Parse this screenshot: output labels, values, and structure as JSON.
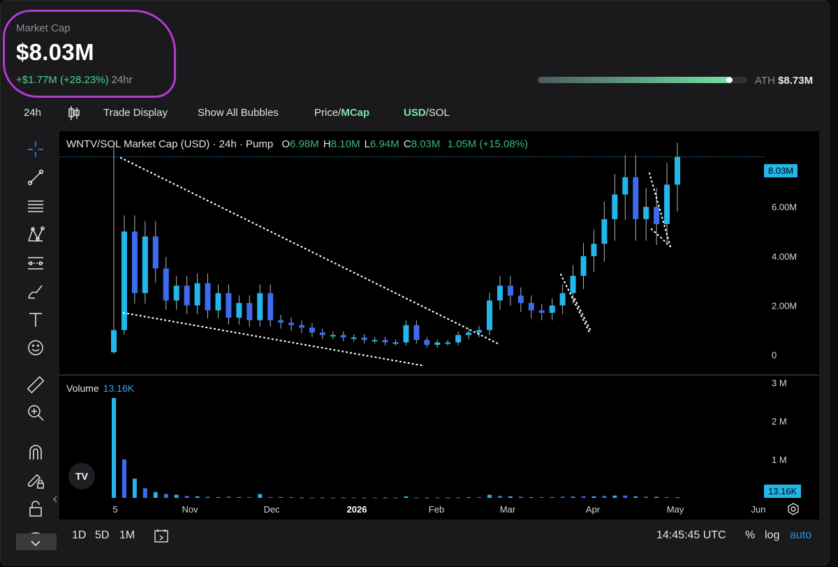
{
  "header": {
    "market_cap_label": "Market Cap",
    "market_cap_value": "$8.03M",
    "change_value": "+$1.77M (+28.23%)",
    "change_period": "24hr",
    "ath_label": "ATH",
    "ath_value": "$8.73M",
    "ath_progress": 0.92
  },
  "toolbar": {
    "interval": "24h",
    "trade_display": "Trade Display",
    "show_bubbles": "Show All Bubbles",
    "price_label": "Price/",
    "mcap_label": "MCap",
    "usd_label": "USD",
    "sol_label": "/SOL"
  },
  "legend": {
    "title": "WNTV/SOL Market Cap (USD) · 24h · Pump",
    "o_key": "O",
    "o_val": "6.98M",
    "h_key": "H",
    "h_val": "8.10M",
    "l_key": "L",
    "l_val": "6.94M",
    "c_key": "C",
    "c_val": "8.03M",
    "change": "1.05M (+15.08%)",
    "price_tag": "8.03M"
  },
  "volume": {
    "label": "Volume",
    "value": "13.16K",
    "tag": "13.16K"
  },
  "left_tools": [
    "crosshair-icon",
    "trendline-icon",
    "horizontal-lines-icon",
    "pattern-icon",
    "measure-lines-icon",
    "brush-icon",
    "text-icon",
    "emoji-icon",
    "ruler-icon",
    "zoom-in-icon",
    "magnet-icon",
    "lock-pencil-icon",
    "lock-icon",
    "eye-icon"
  ],
  "bottom": {
    "range_1d": "1D",
    "range_5d": "5D",
    "range_1m": "1M",
    "time": "14:45:45 UTC",
    "percent": "%",
    "log": "log",
    "auto": "auto"
  },
  "chart_data": {
    "type": "candlestick",
    "title": "WNTV/SOL Market Cap (USD) · 24h · Pump",
    "y_ticks": [
      "8.03M",
      "6.00M",
      "4.00M",
      "2.00M",
      "0"
    ],
    "y_tick_values": [
      8.03,
      6.0,
      4.0,
      2.0,
      0
    ],
    "ylim": [
      0,
      8.5
    ],
    "volume_ticks": [
      "3 M",
      "2 M",
      "1 M"
    ],
    "volume_tick_values": [
      3,
      2,
      1
    ],
    "x_ticks": [
      "5",
      "Nov",
      "Dec",
      "2026",
      "Feb",
      "Mar",
      "Apr",
      "May",
      "Jun"
    ],
    "close_series_millions": [
      1.0,
      5.0,
      2.5,
      4.8,
      3.5,
      2.2,
      2.8,
      2.0,
      2.9,
      1.8,
      2.5,
      1.5,
      2.1,
      1.4,
      2.5,
      1.4,
      1.3,
      1.2,
      1.1,
      0.9,
      0.8,
      0.8,
      0.7,
      0.7,
      0.6,
      0.6,
      0.5,
      0.5,
      1.2,
      0.6,
      0.4,
      0.5,
      0.5,
      0.8,
      0.9,
      1.0,
      2.2,
      2.8,
      2.4,
      2.1,
      1.8,
      1.7,
      2.0,
      2.5,
      3.2,
      4.0,
      4.5,
      5.5,
      6.5,
      7.2,
      5.5,
      6.0,
      5.3,
      6.9,
      8.03
    ],
    "volume_series_millions": [
      2.6,
      1.0,
      0.5,
      0.25,
      0.15,
      0.1,
      0.08,
      0.05,
      0.04,
      0.03,
      0.02,
      0.03,
      0.02,
      0.02,
      0.1,
      0.02,
      0.02,
      0.02,
      0.01,
      0.01,
      0.01,
      0.01,
      0.01,
      0.01,
      0.01,
      0.01,
      0.01,
      0.01,
      0.04,
      0.01,
      0.01,
      0.01,
      0.01,
      0.01,
      0.02,
      0.02,
      0.08,
      0.05,
      0.04,
      0.03,
      0.02,
      0.02,
      0.02,
      0.03,
      0.03,
      0.04,
      0.04,
      0.05,
      0.06,
      0.06,
      0.04,
      0.03,
      0.03,
      0.02,
      0.013
    ],
    "grid": false
  }
}
